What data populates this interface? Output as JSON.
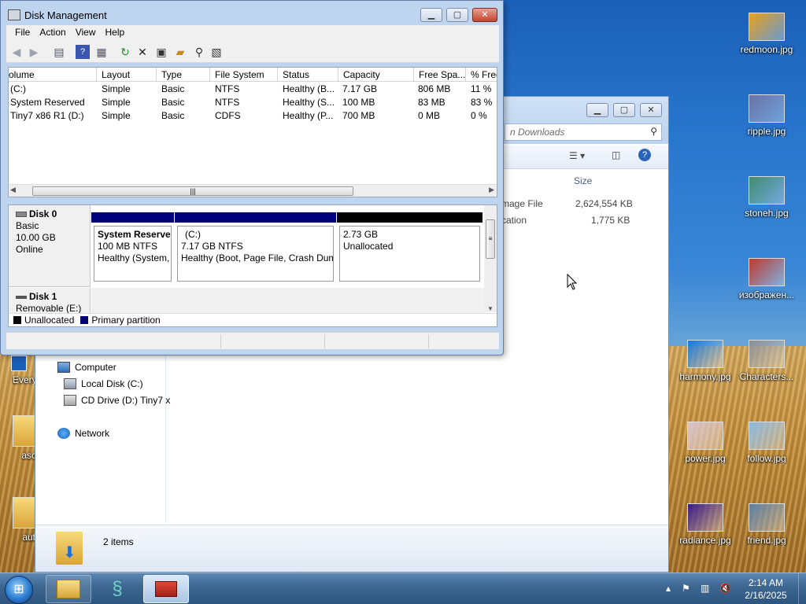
{
  "desktop": {
    "icons_right": [
      {
        "label": "redmoon.jpg",
        "color": "#e8a21a"
      },
      {
        "label": "ripple.jpg",
        "color": "#6b73a8"
      },
      {
        "label": "stoneh.jpg",
        "color": "#3f8c6e"
      },
      {
        "label": "изображен...",
        "color": "#c23a2a"
      },
      {
        "label": "harmony.jpg",
        "color": "#1a78d8"
      },
      {
        "label": "Characters...",
        "color": "#8d8f93"
      },
      {
        "label": "power.jpg",
        "color": "#d9c1c9"
      },
      {
        "label": "follow.jpg",
        "color": "#8cb9e0"
      },
      {
        "label": "radiance.jpg",
        "color": "#3a1a8a"
      },
      {
        "label": "friend.jpg",
        "color": "#5d7fa0"
      }
    ],
    "icons_left": [
      {
        "label": "Everyt"
      },
      {
        "label": "asce"
      },
      {
        "label": "autu"
      }
    ]
  },
  "explorer": {
    "search_placeholder": "n Downloads",
    "col_size": "Size",
    "rows": [
      {
        "name": "mage File",
        "size": "2,624,554 KB"
      },
      {
        "name": "cation",
        "size": "1,775 KB"
      }
    ],
    "nav": {
      "computer": "Computer",
      "local_disk": "Local Disk (C:)",
      "cd_drive": "CD Drive (D:) Tiny7 x",
      "network": "Network"
    },
    "status_items": "2 items"
  },
  "disk_management": {
    "title": "Disk Management",
    "menu": [
      "File",
      "Action",
      "View",
      "Help"
    ],
    "columns": [
      "olume",
      "Layout",
      "Type",
      "File System",
      "Status",
      "Capacity",
      "Free Spa...",
      "% Free"
    ],
    "volumes": [
      [
        "(C:)",
        "Simple",
        "Basic",
        "NTFS",
        "Healthy (B...",
        "7.17 GB",
        "806 MB",
        "11 %"
      ],
      [
        "System Reserved",
        "Simple",
        "Basic",
        "NTFS",
        "Healthy (S...",
        "100 MB",
        "83 MB",
        "83 %"
      ],
      [
        "Tiny7 x86 R1 (D:)",
        "Simple",
        "Basic",
        "CDFS",
        "Healthy (P...",
        "700 MB",
        "0 MB",
        "0 %"
      ]
    ],
    "disk0": {
      "name": "Disk 0",
      "type": "Basic",
      "size": "10.00 GB",
      "state": "Online",
      "partitions": [
        {
          "title": "System Reserve",
          "line1": "100 MB NTFS",
          "line2": "Healthy (System,"
        },
        {
          "title": "(C:)",
          "line1": "7.17 GB NTFS",
          "line2": "Healthy (Boot, Page File, Crash Dum"
        },
        {
          "title": "",
          "line1": "2.73 GB",
          "line2": "Unallocated"
        }
      ]
    },
    "disk1": {
      "name": "Disk 1",
      "type": "Removable (E:)"
    },
    "legend": {
      "unallocated": "Unallocated",
      "primary": "Primary partition",
      "unallocated_color": "#000000",
      "primary_color": "#00007b"
    }
  },
  "taskbar": {
    "time": "2:14 AM",
    "date": "2/16/2025"
  }
}
